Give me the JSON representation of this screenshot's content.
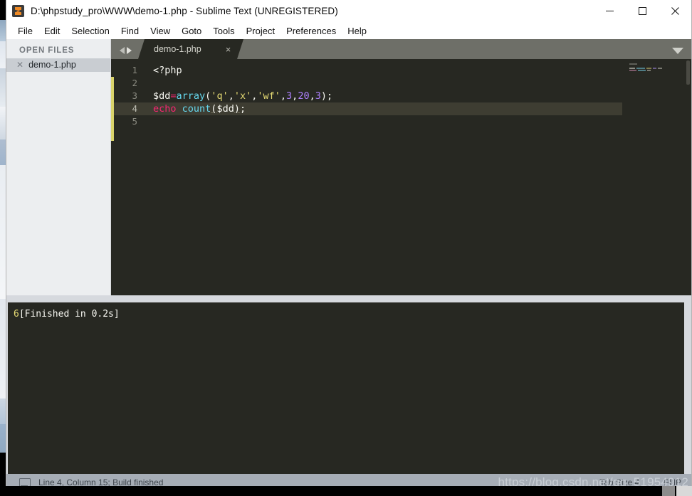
{
  "window": {
    "title": "D:\\phpstudy_pro\\WWW\\demo-1.php - Sublime Text (UNREGISTERED)",
    "logo_icon": "sublime-text-logo-icon",
    "controls": {
      "minimize": "minimize-icon",
      "maximize": "maximize-icon",
      "close": "close-icon"
    }
  },
  "menubar": {
    "items": [
      {
        "label": "File"
      },
      {
        "label": "Edit"
      },
      {
        "label": "Selection"
      },
      {
        "label": "Find"
      },
      {
        "label": "View"
      },
      {
        "label": "Goto"
      },
      {
        "label": "Tools"
      },
      {
        "label": "Project"
      },
      {
        "label": "Preferences"
      },
      {
        "label": "Help"
      }
    ]
  },
  "sidebar": {
    "header": "OPEN FILES",
    "files": [
      {
        "name": "demo-1.php",
        "close_icon": "close-small-icon"
      }
    ]
  },
  "tabbar": {
    "nav_back_icon": "arrow-left-icon",
    "nav_forward_icon": "arrow-right-icon",
    "tabs": [
      {
        "label": "demo-1.php",
        "close": "×",
        "active": true
      }
    ],
    "menu_icon": "chevron-down-icon"
  },
  "editor": {
    "gutter": [
      "1",
      "2",
      "3",
      "4",
      "5"
    ],
    "active_line": 4,
    "lines": [
      {
        "n": 1,
        "tokens": [
          {
            "t": "<?php",
            "c": "tok-tag"
          }
        ]
      },
      {
        "n": 2,
        "tokens": []
      },
      {
        "n": 3,
        "tokens": [
          {
            "t": "$dd",
            "c": "tok-var"
          },
          {
            "t": "=",
            "c": "tok-op"
          },
          {
            "t": "array",
            "c": "tok-fn"
          },
          {
            "t": "(",
            "c": "tok-punc"
          },
          {
            "t": "'q'",
            "c": "tok-str"
          },
          {
            "t": ",",
            "c": "tok-punc"
          },
          {
            "t": "'x'",
            "c": "tok-str"
          },
          {
            "t": ",",
            "c": "tok-punc"
          },
          {
            "t": "'wf'",
            "c": "tok-str"
          },
          {
            "t": ",",
            "c": "tok-punc"
          },
          {
            "t": "3",
            "c": "tok-num"
          },
          {
            "t": ",",
            "c": "tok-punc"
          },
          {
            "t": "20",
            "c": "tok-num"
          },
          {
            "t": ",",
            "c": "tok-punc"
          },
          {
            "t": "3",
            "c": "tok-num"
          },
          {
            "t": ")",
            "c": "tok-punc"
          },
          {
            "t": ";",
            "c": "tok-punc"
          }
        ]
      },
      {
        "n": 4,
        "tokens": [
          {
            "t": "echo",
            "c": "tok-kw"
          },
          {
            "t": " ",
            "c": "tok-punc"
          },
          {
            "t": "count",
            "c": "tok-call"
          },
          {
            "t": "(",
            "c": "tok-punc underline"
          },
          {
            "t": "$dd",
            "c": "tok-var"
          },
          {
            "t": ")",
            "c": "tok-punc underline"
          },
          {
            "t": ";",
            "c": "tok-punc"
          }
        ]
      },
      {
        "n": 5,
        "tokens": []
      }
    ]
  },
  "console": {
    "output_prefix": "6",
    "output_message": "[Finished in 0.2s]"
  },
  "statusbar": {
    "icon": "console-panel-icon",
    "text": "Line 4, Column 15; Build finished",
    "tab_size": "Tab Size 4",
    "syntax": "PHP"
  },
  "watermark": {
    "text": "https://blog.csdn.net/qq_51954912"
  },
  "colors": {
    "editor_bg": "#272822",
    "active_line_bg": "#3e3d32",
    "accent_bar": "#d9d36b",
    "tabbar_bg": "#6e6f68",
    "sidebar_bg": "#eceef0",
    "statusbar_bg": "#a6adb6",
    "string": "#e6db74",
    "number": "#ae81ff",
    "keyword": "#f92672",
    "function": "#66d9ef",
    "text": "#f8f8f2",
    "logo_orange": "#f08a24"
  }
}
